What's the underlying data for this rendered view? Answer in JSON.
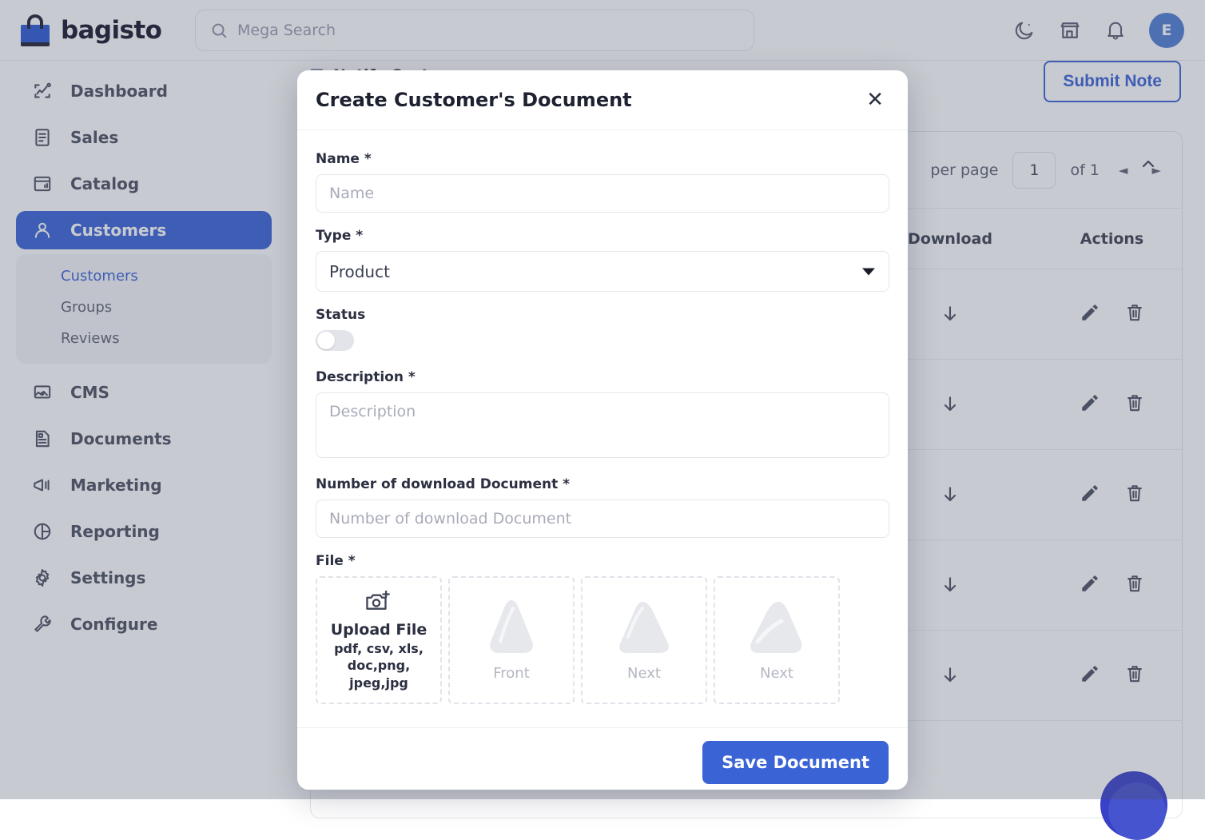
{
  "header": {
    "brand": "bagisto",
    "search_placeholder": "Mega Search",
    "icons": {
      "search": "search-icon",
      "dark_mode": "moon-icon",
      "store": "store-icon",
      "notifications": "bell-icon"
    },
    "avatar_initial": "E"
  },
  "sidebar": {
    "items": [
      {
        "label": "Dashboard",
        "icon": "dashboard-icon",
        "active": false
      },
      {
        "label": "Sales",
        "icon": "sales-icon",
        "active": false
      },
      {
        "label": "Catalog",
        "icon": "catalog-icon",
        "active": false
      },
      {
        "label": "Customers",
        "icon": "customers-icon",
        "active": true
      },
      {
        "label": "CMS",
        "icon": "cms-icon",
        "active": false
      },
      {
        "label": "Documents",
        "icon": "documents-icon",
        "active": false
      },
      {
        "label": "Marketing",
        "icon": "marketing-icon",
        "active": false
      },
      {
        "label": "Reporting",
        "icon": "reporting-icon",
        "active": false
      },
      {
        "label": "Settings",
        "icon": "settings-icon",
        "active": false
      },
      {
        "label": "Configure",
        "icon": "configure-icon",
        "active": false
      }
    ],
    "sub_items": [
      {
        "label": "Customers",
        "current": true
      },
      {
        "label": "Groups",
        "current": false
      },
      {
        "label": "Reviews",
        "current": false
      }
    ]
  },
  "background": {
    "notify_customer_label": "Notify Customer",
    "submit_note_label": "Submit Note",
    "pagination": {
      "per_page_label": "per page",
      "page_value": "1",
      "of_label": "of 1",
      "prev_icon": "chevron-left-icon",
      "next_icon": "chevron-right-icon"
    },
    "table": {
      "columns": [
        "Download",
        "Actions"
      ],
      "rows": [
        {
          "download": "download-icon",
          "edit": "pencil-icon",
          "delete": "trash-icon"
        },
        {
          "download": "download-icon",
          "edit": "pencil-icon",
          "delete": "trash-icon"
        },
        {
          "download": "download-icon",
          "edit": "pencil-icon",
          "delete": "trash-icon"
        },
        {
          "download": "download-icon",
          "edit": "pencil-icon",
          "delete": "trash-icon"
        },
        {
          "download": "download-icon",
          "edit": "pencil-icon",
          "delete": "trash-icon"
        }
      ]
    },
    "collapse_icon": "chevron-up-icon"
  },
  "modal": {
    "title": "Create Customer's Document",
    "close_icon": "close-icon",
    "fields": {
      "name": {
        "label": "Name *",
        "placeholder": "Name",
        "value": ""
      },
      "type": {
        "label": "Type *",
        "selected": "Product",
        "caret_icon": "chevron-down-icon"
      },
      "status": {
        "label": "Status",
        "checked": false
      },
      "description": {
        "label": "Description *",
        "placeholder": "Description",
        "value": ""
      },
      "downloads": {
        "label": "Number of download Document *",
        "placeholder": "Number of download Document",
        "value": ""
      },
      "file": {
        "label": "File *",
        "upload_icon": "camera-plus-icon",
        "upload_title": "Upload File",
        "upload_formats": "pdf, csv, xls,\ndoc,png, jpeg,jpg",
        "thumbnails": [
          {
            "label": "Front",
            "icon": "broken-image-icon"
          },
          {
            "label": "Next",
            "icon": "broken-image-icon"
          },
          {
            "label": "Next",
            "icon": "broken-image-icon"
          }
        ]
      }
    },
    "save_label": "Save Document"
  },
  "colors": {
    "accent": "#3a63d6",
    "sidebar_active": "#3a63d6",
    "fab": "#3a41c9",
    "text": "#2b2f40"
  }
}
